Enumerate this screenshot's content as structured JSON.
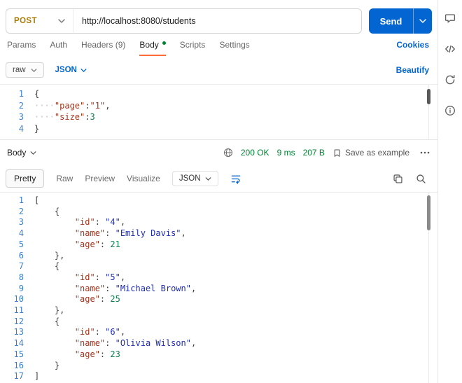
{
  "request": {
    "method": "POST",
    "url": "http://localhost:8080/students",
    "send_label": "Send"
  },
  "request_tabs": {
    "items": [
      "Params",
      "Auth",
      "Headers (9)",
      "Body",
      "Scripts",
      "Settings"
    ],
    "active": "Body",
    "cookies": "Cookies"
  },
  "body_toolbar": {
    "format": "raw",
    "language": "JSON",
    "beautify": "Beautify"
  },
  "request_editor": {
    "lines": [
      [
        [
          "{",
          "p"
        ]
      ],
      [
        [
          "····",
          "w"
        ],
        [
          "\"page\"",
          "k"
        ],
        [
          ":",
          "p"
        ],
        [
          "\"1\"",
          "k"
        ],
        [
          ",",
          "p"
        ]
      ],
      [
        [
          "····",
          "w"
        ],
        [
          "\"size\"",
          "k"
        ],
        [
          ":",
          "p"
        ],
        [
          "3",
          "n"
        ]
      ],
      [
        [
          "}",
          "p"
        ]
      ]
    ]
  },
  "response": {
    "body_label": "Body",
    "status": "200 OK",
    "time": "9 ms",
    "size": "207 B",
    "save_label": "Save as example",
    "tabs": [
      "Pretty",
      "Raw",
      "Preview",
      "Visualize"
    ],
    "active_tab": "Pretty",
    "language": "JSON"
  },
  "response_editor": {
    "lines": [
      [
        [
          "[",
          "p"
        ]
      ],
      [
        [
          "    {",
          "p"
        ]
      ],
      [
        [
          "        ",
          "p"
        ],
        [
          "\"id\"",
          "k"
        ],
        [
          ": ",
          "p"
        ],
        [
          "\"4\"",
          "s"
        ],
        [
          ",",
          "p"
        ]
      ],
      [
        [
          "        ",
          "p"
        ],
        [
          "\"name\"",
          "k"
        ],
        [
          ": ",
          "p"
        ],
        [
          "\"Emily Davis\"",
          "s"
        ],
        [
          ",",
          "p"
        ]
      ],
      [
        [
          "        ",
          "p"
        ],
        [
          "\"age\"",
          "k"
        ],
        [
          ": ",
          "p"
        ],
        [
          "21",
          "n"
        ]
      ],
      [
        [
          "    },",
          "p"
        ]
      ],
      [
        [
          "    {",
          "p"
        ]
      ],
      [
        [
          "        ",
          "p"
        ],
        [
          "\"id\"",
          "k"
        ],
        [
          ": ",
          "p"
        ],
        [
          "\"5\"",
          "s"
        ],
        [
          ",",
          "p"
        ]
      ],
      [
        [
          "        ",
          "p"
        ],
        [
          "\"name\"",
          "k"
        ],
        [
          ": ",
          "p"
        ],
        [
          "\"Michael Brown\"",
          "s"
        ],
        [
          ",",
          "p"
        ]
      ],
      [
        [
          "        ",
          "p"
        ],
        [
          "\"age\"",
          "k"
        ],
        [
          ": ",
          "p"
        ],
        [
          "25",
          "n"
        ]
      ],
      [
        [
          "    },",
          "p"
        ]
      ],
      [
        [
          "    {",
          "p"
        ]
      ],
      [
        [
          "        ",
          "p"
        ],
        [
          "\"id\"",
          "k"
        ],
        [
          ": ",
          "p"
        ],
        [
          "\"6\"",
          "s"
        ],
        [
          ",",
          "p"
        ]
      ],
      [
        [
          "        ",
          "p"
        ],
        [
          "\"name\"",
          "k"
        ],
        [
          ": ",
          "p"
        ],
        [
          "\"Olivia Wilson\"",
          "s"
        ],
        [
          ",",
          "p"
        ]
      ],
      [
        [
          "        ",
          "p"
        ],
        [
          "\"age\"",
          "k"
        ],
        [
          ": ",
          "p"
        ],
        [
          "23",
          "n"
        ]
      ],
      [
        [
          "    }",
          "p"
        ]
      ],
      [
        [
          "]",
          "p"
        ]
      ]
    ]
  },
  "right_rail": {
    "icons": [
      "comment",
      "code",
      "refresh",
      "info"
    ]
  },
  "colors": {
    "method_post": "#ad7a03",
    "accent_blue": "#0265d2",
    "success_green": "#007f31",
    "active_tab_underline": "#ff6c37"
  }
}
